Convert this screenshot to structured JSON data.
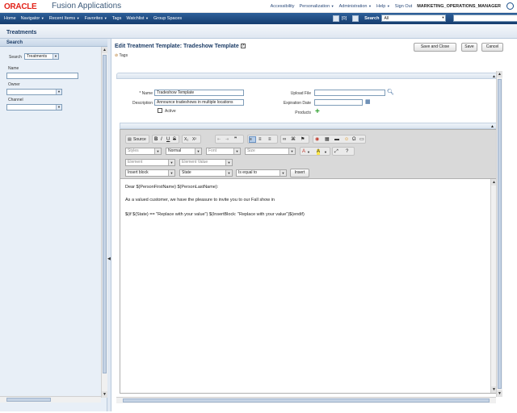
{
  "header": {
    "logo": "ORACLE",
    "app_name": "Fusion Applications",
    "links": [
      "Accessibility",
      "Personalization",
      "Administration",
      "Help",
      "Sign Out"
    ],
    "user": "MARKETING_OPERATIONS_MANAGER"
  },
  "nav": {
    "items": [
      "Home",
      "Navigator",
      "Recent Items",
      "Favorites",
      "Tags",
      "Watchlist",
      "Group Spaces"
    ],
    "count": "[0]",
    "search_label": "Search",
    "search_scope": "All"
  },
  "page": {
    "title": "Treatments"
  },
  "left_panel": {
    "header": "Search",
    "search_label": "Search",
    "search_value": "Treatments",
    "name_label": "Name",
    "owner_label": "Owner",
    "channel_label": "Channel"
  },
  "main": {
    "title": "Edit Treatment Template: Tradeshow Template",
    "tags_label": "Tags",
    "buttons": {
      "save_close": "Save and Close",
      "save": "Save",
      "cancel": "Cancel"
    },
    "form": {
      "name_label": "* Name",
      "name_value": "Tradeshow Template",
      "description_label": "Description",
      "description_value": "Announce tradeshows in multiple locations",
      "active_label": "Active",
      "upload_label": "Upload File",
      "expiration_label": "Expiration Date",
      "products_label": "Products"
    }
  },
  "editor": {
    "source_label": "Source",
    "styles": "Styles",
    "format": "Normal",
    "font": "Font",
    "size": "Size",
    "element": "Element",
    "element_value": "Element Value",
    "insert_block": "Insert block",
    "state": "State",
    "operator": "Is equal to",
    "insert_button": "Insert",
    "content": [
      "Dear $(PersonFirstName) $(PersonLastName):",
      "As a valued customer, we have the pleasure to invite you to our Fall show in",
      "$(if $(State) == \"Replace with your value\") $(InsertBlock: \"Replace with your value\")$(endif)"
    ]
  }
}
